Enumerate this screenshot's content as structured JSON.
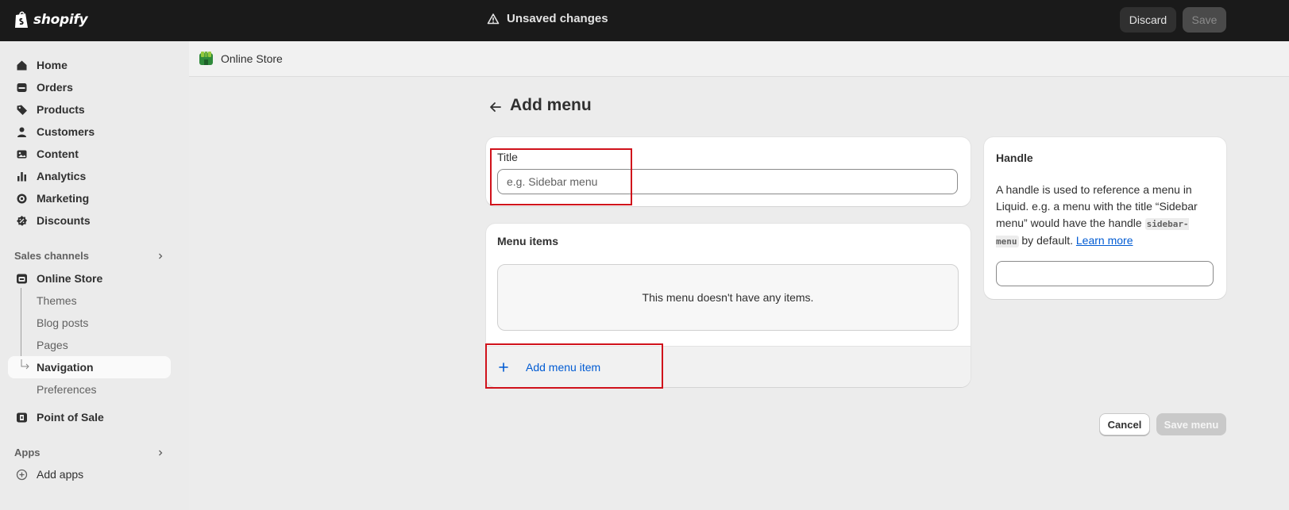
{
  "topbar": {
    "logo_text": "shopify",
    "status_text": "Unsaved changes",
    "discard_label": "Discard",
    "save_label": "Save"
  },
  "sidebar": {
    "items": [
      {
        "label": "Home",
        "icon": "home-icon"
      },
      {
        "label": "Orders",
        "icon": "orders-icon"
      },
      {
        "label": "Products",
        "icon": "tag-icon"
      },
      {
        "label": "Customers",
        "icon": "person-icon"
      },
      {
        "label": "Content",
        "icon": "content-icon"
      },
      {
        "label": "Analytics",
        "icon": "bar-chart-icon"
      },
      {
        "label": "Marketing",
        "icon": "target-icon"
      },
      {
        "label": "Discounts",
        "icon": "discount-icon"
      }
    ],
    "sales_channels_label": "Sales channels",
    "online_store": {
      "label": "Online Store",
      "subitems": [
        "Themes",
        "Blog posts",
        "Pages",
        "Navigation",
        "Preferences"
      ],
      "active": "Navigation"
    },
    "point_of_sale_label": "Point of Sale",
    "apps_label": "Apps",
    "add_apps_label": "Add apps"
  },
  "subheader": {
    "store_label": "Online Store"
  },
  "main": {
    "page_title": "Add menu",
    "title_field": {
      "label": "Title",
      "placeholder": "e.g. Sidebar menu",
      "value": ""
    },
    "menu_items": {
      "heading": "Menu items",
      "empty_text": "This menu doesn't have any items.",
      "add_label": "Add menu item"
    },
    "handle": {
      "heading": "Handle",
      "desc_1": "A handle is used to reference a menu in Liquid. e.g. a menu with the title “Sidebar menu” would have the handle",
      "code": "sidebar-menu",
      "desc_2": "by default.",
      "link": "Learn more",
      "value": ""
    },
    "cancel_label": "Cancel",
    "save_menu_label": "Save menu"
  },
  "colors": {
    "topbar": "#1a1a1a",
    "link": "#005bd3",
    "highlight": "#d0121b"
  }
}
